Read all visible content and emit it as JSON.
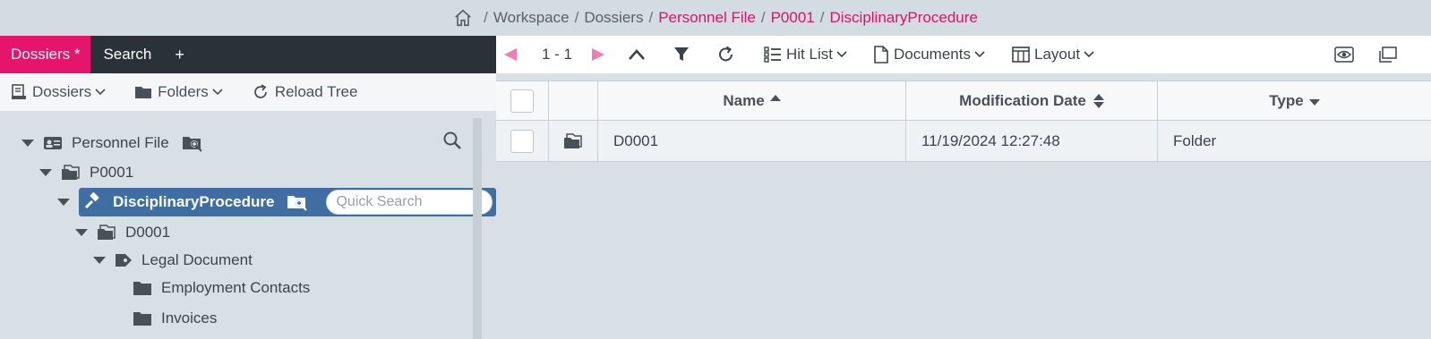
{
  "breadcrumb": {
    "home_icon": "home-icon",
    "workspace": "Workspace",
    "dossiers": "Dossiers",
    "personnel_file": "Personnel File",
    "p0001": "P0001",
    "current": "DisciplinaryProcedure",
    "separator": "/"
  },
  "tabs": {
    "dossiers": "Dossiers *",
    "search": "Search",
    "add": "+"
  },
  "left_toolbar": {
    "dossiers": "Dossiers",
    "folders": "Folders",
    "reload": "Reload Tree"
  },
  "tree": {
    "personnel_file": "Personnel File",
    "p0001": "P0001",
    "disciplinary": "DisciplinaryProcedure",
    "quick_search_placeholder": "Quick Search",
    "d0001": "D0001",
    "legal_document": "Legal Document",
    "employment_contacts": "Employment Contacts",
    "invoices": "Invoices"
  },
  "right_toolbar": {
    "range": "1 - 1",
    "hit_list": "Hit List",
    "documents": "Documents",
    "layout": "Layout"
  },
  "grid": {
    "columns": [
      "Name",
      "Modification Date",
      "Type"
    ],
    "rows": [
      {
        "name": "D0001",
        "modified": "11/19/2024 12:27:48",
        "type": "Folder"
      }
    ]
  },
  "colors": {
    "accent": "#e5156b",
    "selection": "#3f6fa2",
    "dark_bar": "#2a3138",
    "arrow_pink": "#f07cb0"
  }
}
